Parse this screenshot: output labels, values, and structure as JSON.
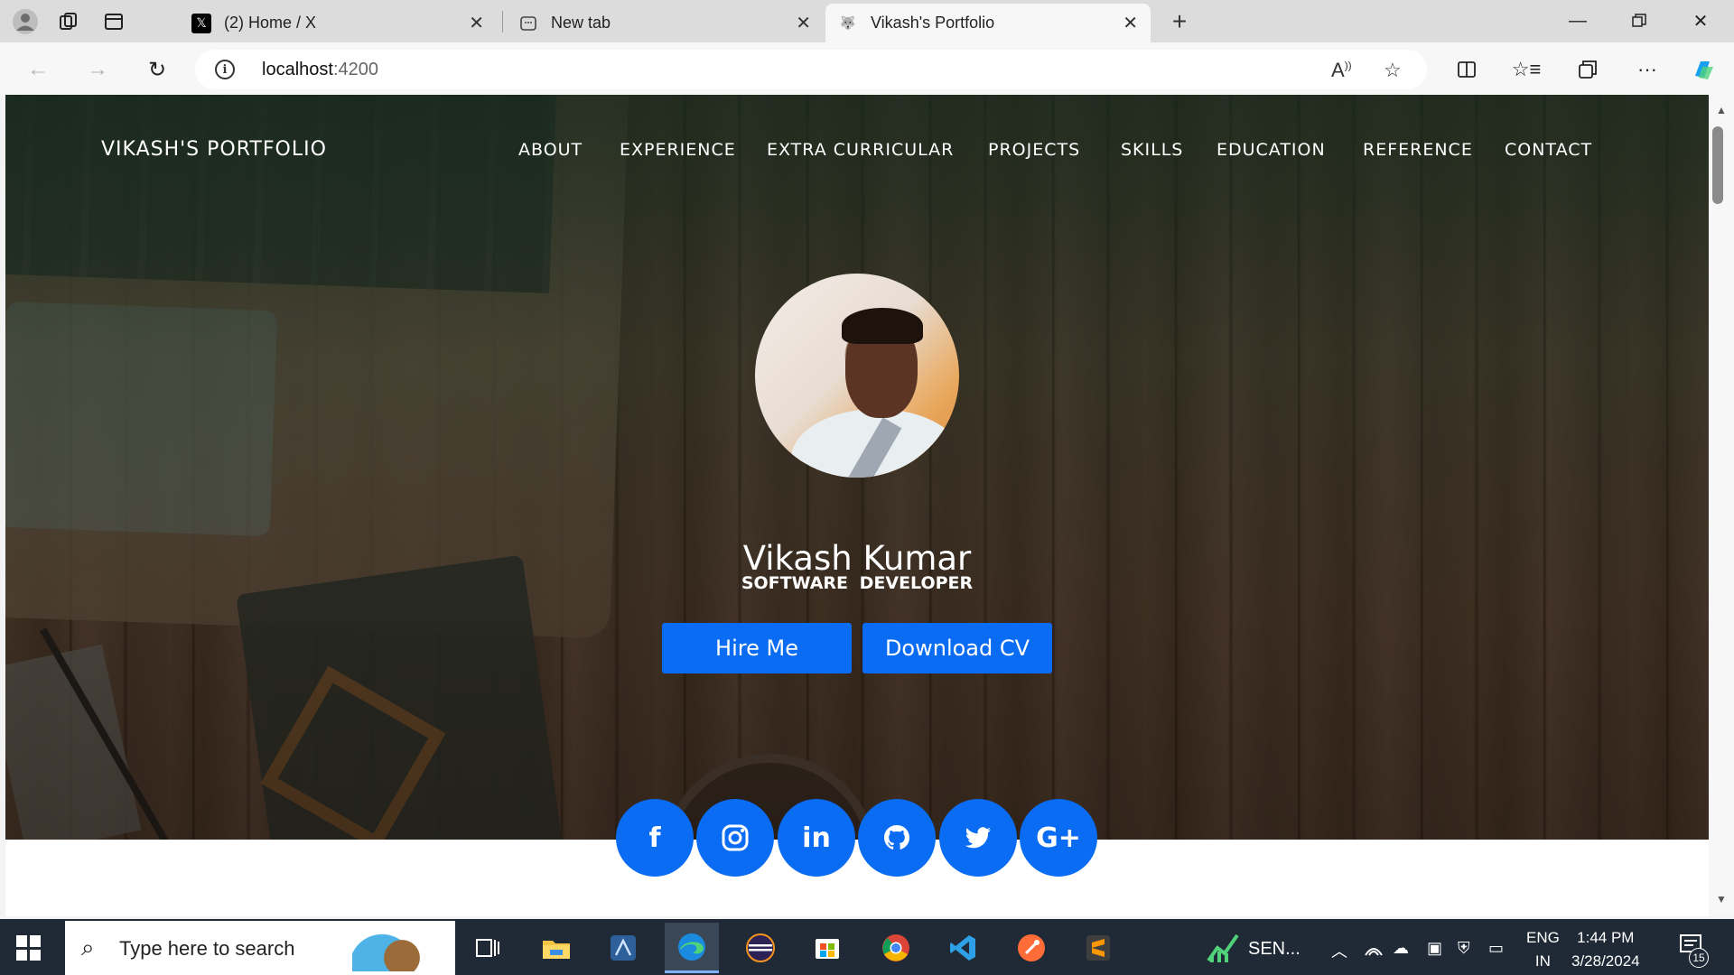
{
  "browser": {
    "tabs": [
      {
        "title": "(2) Home / X",
        "icon": "x-logo-icon"
      },
      {
        "title": "New tab",
        "icon": "new-tab-icon"
      },
      {
        "title": "Vikash's Portfolio",
        "icon": "wolf-icon"
      }
    ],
    "url_host": "localhost",
    "url_port": ":4200"
  },
  "site": {
    "brand": "VIKASH'S PORTFOLIO",
    "nav": [
      "ABOUT",
      "EXPERIENCE",
      "EXTRA CURRICULAR",
      "PROJECTS",
      "SKILLS",
      "EDUCATION",
      "REFERENCE",
      "CONTACT"
    ],
    "name": "Vikash Kumar",
    "role": "SOFTWARE  DEVELOPER",
    "hire_label": "Hire Me",
    "cv_label": "Download CV",
    "social": [
      {
        "name": "facebook",
        "glyph": "f"
      },
      {
        "name": "instagram",
        "glyph": ""
      },
      {
        "name": "linkedin",
        "glyph": "in"
      },
      {
        "name": "github",
        "glyph": ""
      },
      {
        "name": "twitter",
        "glyph": ""
      },
      {
        "name": "google-plus",
        "glyph": "G+"
      }
    ],
    "accent_color": "#0a6cf2"
  },
  "taskbar": {
    "search_placeholder": "Type here to search",
    "stock_label": "SEN...",
    "lang_top": "ENG",
    "lang_bottom": "IN",
    "time": "1:44 PM",
    "date": "3/28/2024",
    "notification_count": "15"
  }
}
